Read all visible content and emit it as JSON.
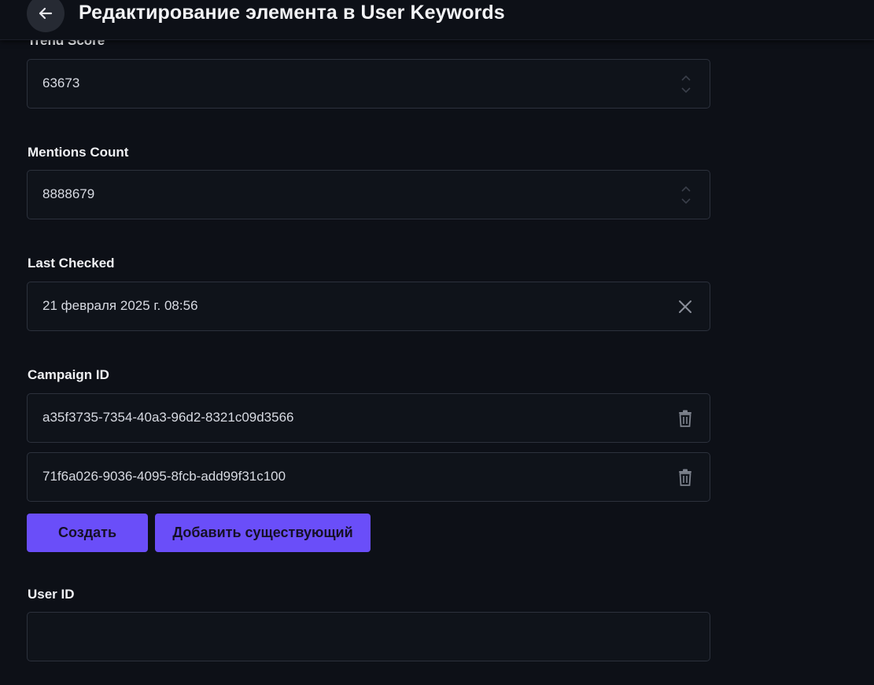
{
  "header": {
    "title": "Редактирование элемента в User Keywords",
    "back_icon": "arrow-left-icon"
  },
  "fields": {
    "trend_score": {
      "label": "Trend Score",
      "value": "63673"
    },
    "mentions_count": {
      "label": "Mentions Count",
      "value": "8888679"
    },
    "last_checked": {
      "label": "Last Checked",
      "value": "21 февраля 2025 г. 08:56"
    },
    "campaign_id": {
      "label": "Campaign ID",
      "items": [
        "a35f3735-7354-40a3-96d2-8321c09d3566",
        "71f6a026-9036-4095-8fcb-add99f31c100"
      ]
    },
    "user_id": {
      "label": "User ID",
      "value": ""
    }
  },
  "actions": {
    "create_label": "Создать",
    "add_existing_label": "Добавить существующий"
  },
  "colors": {
    "background": "#0d1017",
    "accent": "#6a4ef9",
    "border": "#2c313c"
  }
}
